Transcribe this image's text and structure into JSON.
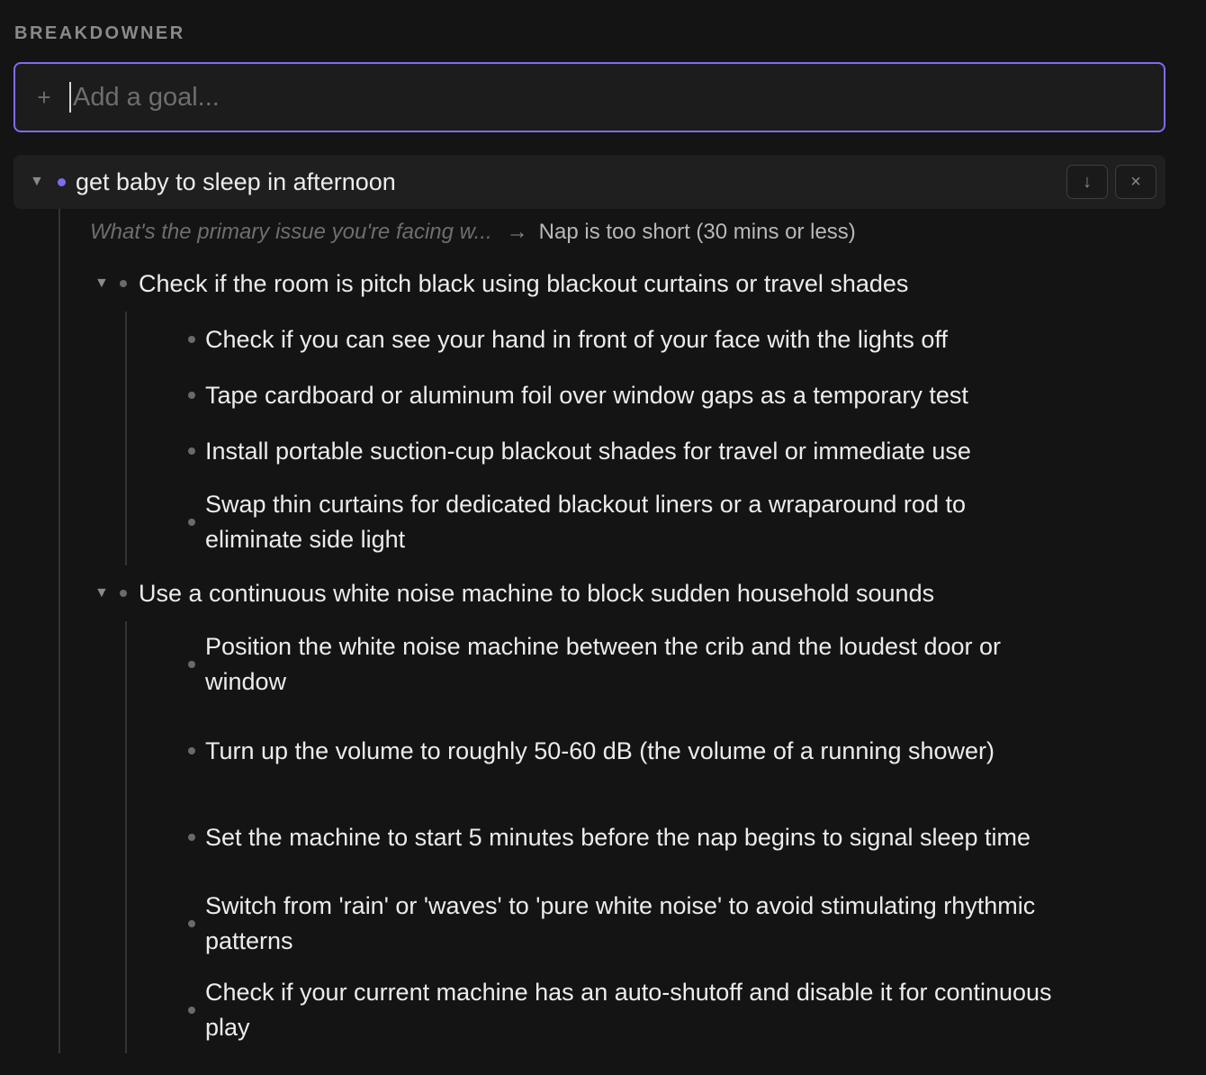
{
  "app": {
    "title": "BREAKDOWNER"
  },
  "goal_input": {
    "placeholder": "Add a goal...",
    "value": ""
  },
  "icons": {
    "plus": "+",
    "caret_down": "▼",
    "arrow_down": "↓",
    "close": "×",
    "arrow_right": "→"
  },
  "colors": {
    "accent": "#7c6df0",
    "background": "#141414",
    "row_background": "#1f1f1f"
  },
  "goal": {
    "title": "get baby to sleep in afternoon",
    "qa": {
      "question": "What's the primary issue you're facing w...",
      "answer": "Nap is too short (30 mins or less)"
    },
    "steps": [
      {
        "label": "Check if the room is pitch black using blackout curtains or travel shades",
        "substeps": [
          "Check if you can see your hand in front of your face with the lights off",
          "Tape cardboard or aluminum foil over window gaps as a temporary test",
          "Install portable suction-cup blackout shades for travel or immediate use",
          "Swap thin curtains for dedicated blackout liners or a wraparound rod to eliminate side light"
        ]
      },
      {
        "label": "Use a continuous white noise machine to block sudden household sounds",
        "substeps": [
          "Position the white noise machine between the crib and the loudest door or window",
          "Turn up the volume to roughly 50-60 dB (the volume of a running shower)",
          "Set the machine to start 5 minutes before the nap begins to signal sleep time",
          "Switch from 'rain' or 'waves' to 'pure white noise' to avoid stimulating rhythmic patterns",
          "Check if your current machine has an auto-shutoff and disable it for continuous play"
        ]
      }
    ]
  }
}
